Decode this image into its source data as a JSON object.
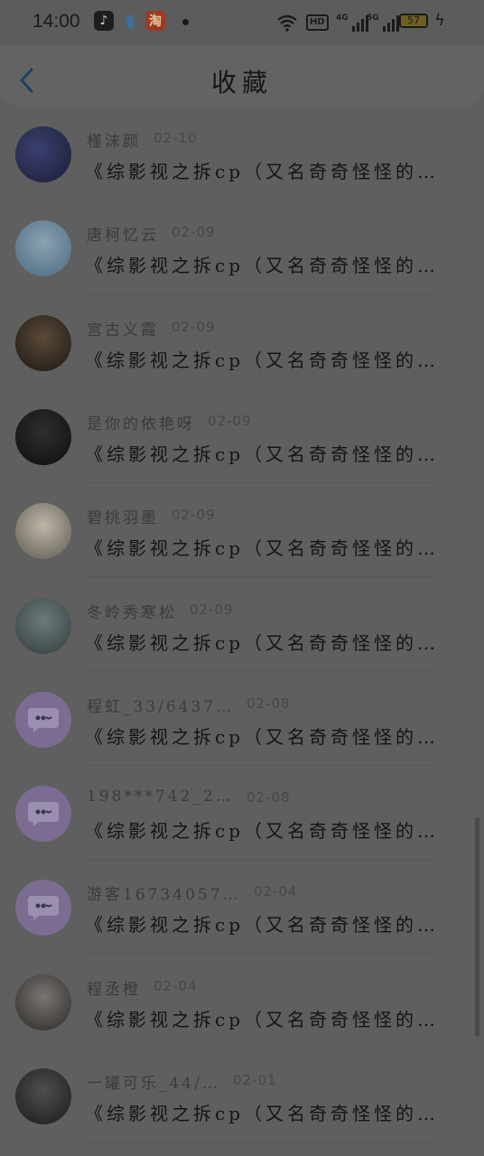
{
  "status_bar": {
    "time": "14:00",
    "apps": [
      "tiktok-icon",
      "qq-icon",
      "taobao-icon"
    ],
    "taobao_char": "淘",
    "hd": "HD",
    "net1": "4G",
    "net2": "5G",
    "battery": "57"
  },
  "header": {
    "back_glyph": "<",
    "title": "收藏"
  },
  "list": [
    {
      "name": "槿沫颜",
      "date": "02-10",
      "text": "《综影视之拆cp（又名奇奇怪怪的…",
      "avatar": "photo"
    },
    {
      "name": "唐柯忆云",
      "date": "02-09",
      "text": "《综影视之拆cp（又名奇奇怪怪的…",
      "avatar": "photo"
    },
    {
      "name": "宫古义霞",
      "date": "02-09",
      "text": "《综影视之拆cp（又名奇奇怪怪的…",
      "avatar": "photo"
    },
    {
      "name": "是你的依艳呀",
      "date": "02-09",
      "text": "《综影视之拆cp（又名奇奇怪怪的…",
      "avatar": "photo"
    },
    {
      "name": "碧桃羽墨",
      "date": "02-09",
      "text": "《综影视之拆cp（又名奇奇怪怪的…",
      "avatar": "photo"
    },
    {
      "name": "冬岭秀寒松",
      "date": "02-09",
      "text": "《综影视之拆cp（又名奇奇怪怪的…",
      "avatar": "photo"
    },
    {
      "name": "程虹_33/6437…",
      "date": "02-08",
      "text": "《综影视之拆cp（又名奇奇怪怪的…",
      "avatar": "default"
    },
    {
      "name": "198***742_2…",
      "date": "02-08",
      "text": "《综影视之拆cp（又名奇奇怪怪的…",
      "avatar": "default"
    },
    {
      "name": "游客16734057…",
      "date": "02-04",
      "text": "《综影视之拆cp（又名奇奇怪怪的…",
      "avatar": "default"
    },
    {
      "name": "程丞橙",
      "date": "02-04",
      "text": "《综影视之拆cp（又名奇奇怪怪的…",
      "avatar": "photo"
    },
    {
      "name": "一罐可乐_44/…",
      "date": "02-01",
      "text": "《综影视之拆cp（又名奇奇怪怪的…",
      "avatar": "photo"
    }
  ],
  "colors": {
    "overlay_bg": "#5f5f5f",
    "accent_back": "#1f3f62",
    "default_avatar": "#7c6c92"
  }
}
